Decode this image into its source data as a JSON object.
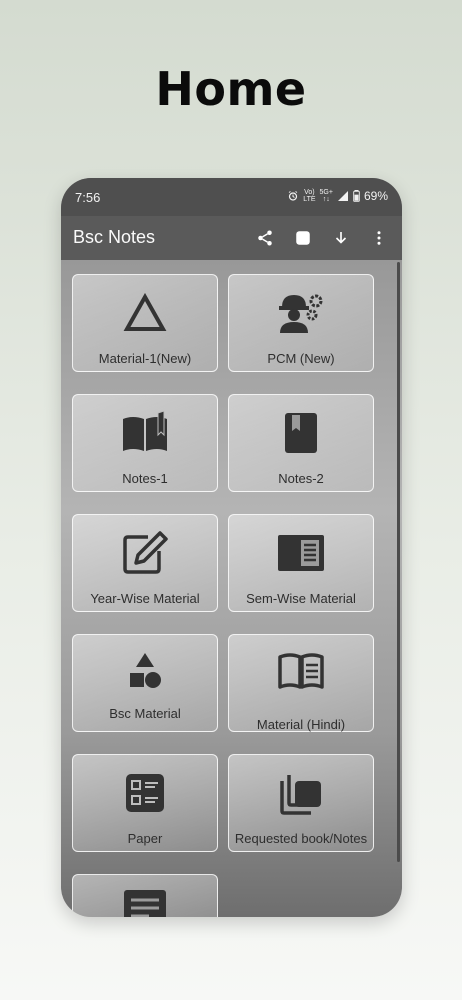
{
  "headline": "Home",
  "status_bar": {
    "time": "7:56",
    "net_top": "Vo)",
    "net_bottom": "LTE",
    "gen_top": "5G+",
    "gen_bottom": "↑↓",
    "battery": "69%"
  },
  "app_bar": {
    "title": "Bsc Notes",
    "actions": [
      "share-icon",
      "stop-icon",
      "download-icon",
      "more-vert-icon"
    ]
  },
  "tiles": [
    {
      "label": "Material-1(New)",
      "icon": "triangle-icon"
    },
    {
      "label": "PCM (New)",
      "icon": "engineer-gear-icon"
    },
    {
      "label": "Notes-1",
      "icon": "open-book-icon"
    },
    {
      "label": "Notes-2",
      "icon": "bookmark-book-icon"
    },
    {
      "label": "Year-Wise Material",
      "icon": "edit-icon"
    },
    {
      "label": "Sem-Wise Material",
      "icon": "article-icon"
    },
    {
      "label": "Bsc Material",
      "icon": "shapes-icon"
    },
    {
      "label": "Material (Hindi)",
      "icon": "menu-book-icon"
    },
    {
      "label": "Paper",
      "icon": "checklist-icon"
    },
    {
      "label": "Requested book/Notes",
      "icon": "library-icon"
    },
    {
      "label": "",
      "icon": "notes-icon"
    }
  ]
}
